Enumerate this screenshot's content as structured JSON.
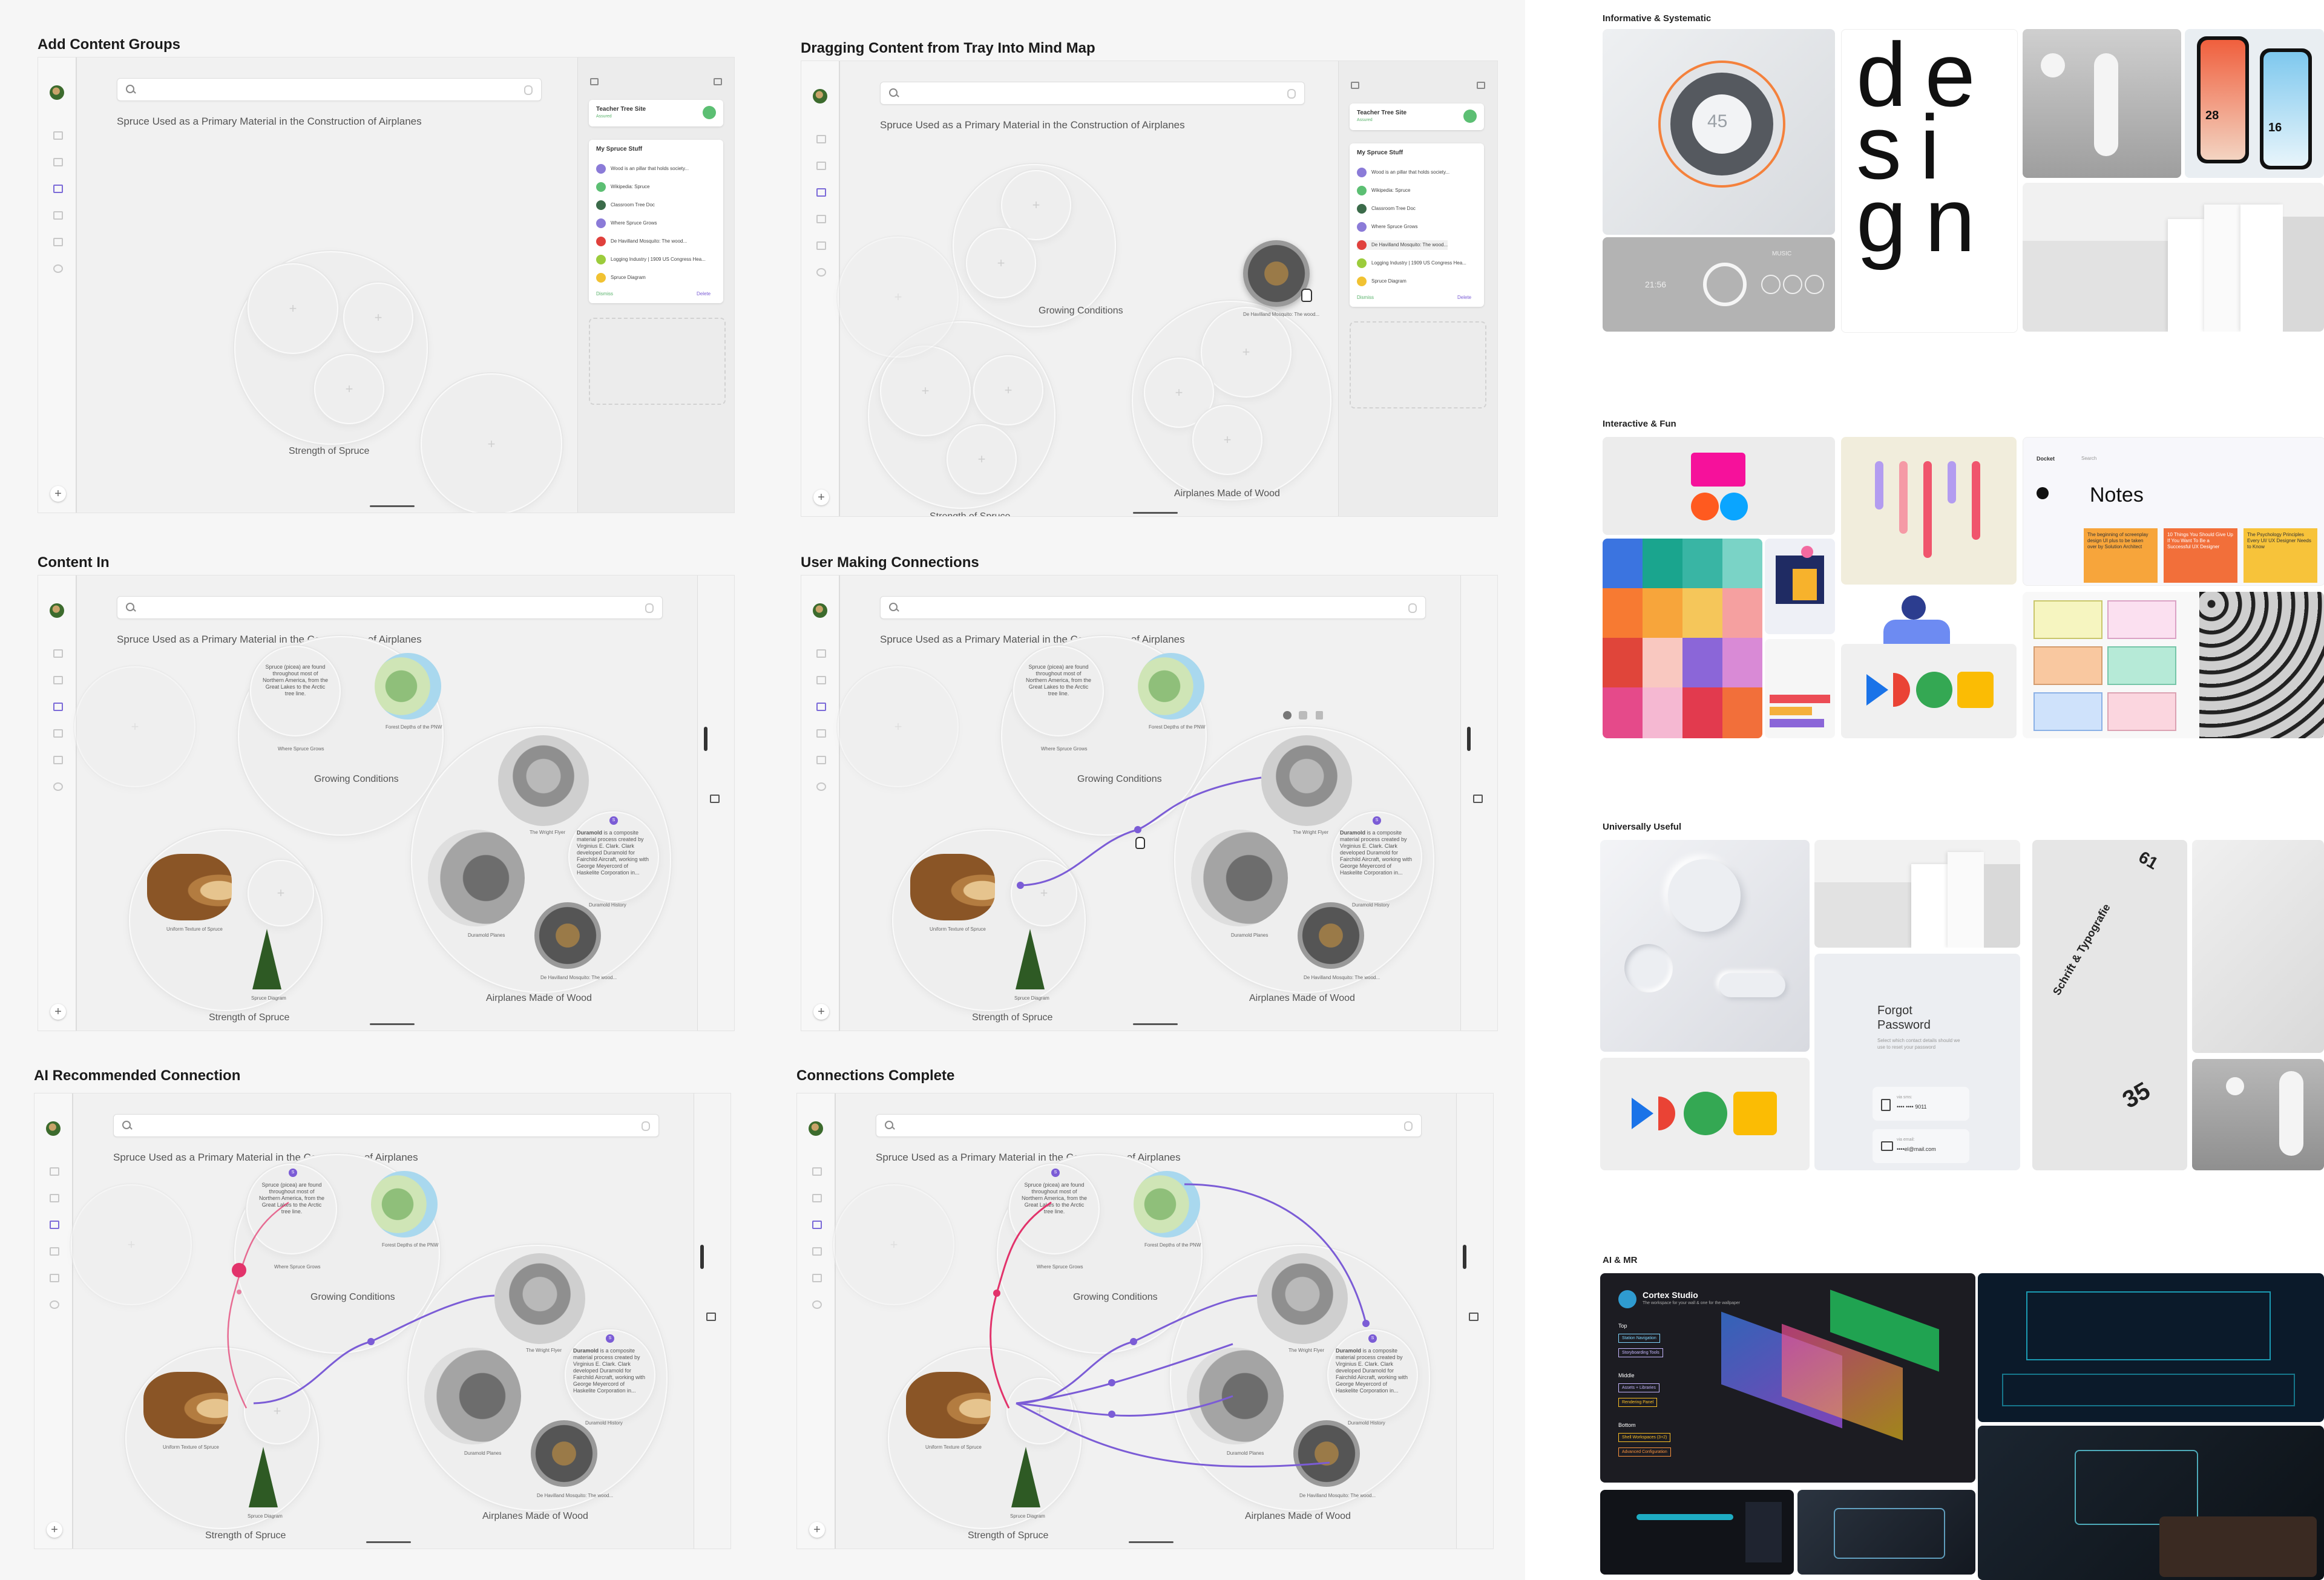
{
  "panels": [
    {
      "title": "Add Content Groups"
    },
    {
      "title": "Dragging Content from Tray Into Mind Map"
    },
    {
      "title": "Content In"
    },
    {
      "title": "User Making Connections"
    },
    {
      "title": "AI Recommended Connection"
    },
    {
      "title": "Connections Complete"
    }
  ],
  "mindmap": {
    "title": "Spruce Used as a Primary Material in the Construction of Airplanes",
    "strength": "Strength of Spruce",
    "growing": "Growing Conditions",
    "airplanes": "Airplanes Made of Wood",
    "where_grown": "Where Spruce Grows",
    "forest_depths": "Forest Depths of the PNW",
    "uniform_texture": "Uniform Texture of Spruce",
    "spruce_diagram": "Spruce Diagram",
    "wright_flyer": "The Wright Flyer",
    "duramold_planes": "Duramold Planes",
    "mosquito": "De Havilland Mosquito: The wood...",
    "duramold_history": "Duramold History",
    "spruce_blurb": "Spruce (picea) are found throughout most of Northern America, from the Great Lakes to the Arctic tree line.",
    "duramold_word": "Duramold",
    "duramold_blurb": "is a composite material process created by Virginius E. Clark. Clark developed Duramold for Fairchild Aircraft, working with George Meyercord of Haskelite Corporation in...",
    "duramold_blurb_short": "is a composite material process created by Virginius E. Clark. Clark developed Duramold for Fairchild Aircraft, working with George Meyercord of Haskelite Corporation in..."
  },
  "tray": {
    "teacher_site": "Teacher Tree Site",
    "teacher_status": "Assured",
    "stuff_title": "My Spruce Stuff",
    "items": [
      {
        "label": "Wood is an pillar that holds society...",
        "color": "#8b7bd8"
      },
      {
        "label": "Wikipedia: Spruce",
        "color": "#5cbf73"
      },
      {
        "label": "Classroom Tree Doc",
        "color": "#3b6b4a"
      },
      {
        "label": "Where Spruce Grows",
        "color": "#8b7bd8"
      },
      {
        "label": "De Havilland Mosquito: The wood...",
        "color": "#e0403c"
      },
      {
        "label": "Logging Industry | 1909 US Congress Hea...",
        "color": "#9ccc3c"
      },
      {
        "label": "Spruce Diagram",
        "color": "#f1c232"
      }
    ],
    "footer_left": "Dismiss",
    "footer_right": "Delete"
  },
  "moodboard": {
    "sections": [
      {
        "title": "Informative & Systematic"
      },
      {
        "title": "Interactive & Fun"
      },
      {
        "title": "Universally Useful"
      },
      {
        "title": "AI & MR"
      }
    ],
    "dial_value": "45",
    "time_value": "21:56",
    "music_label": "MUSIC",
    "phone_date_1": "28",
    "phone_date_2": "16",
    "notes_app": "Docket",
    "notes_search": "Search",
    "notes_title": "Notes",
    "notes_cards": [
      "The beginning of screenplay design UI plus to be taken over by Solution Architect",
      "10 Things You Should Give Up If You Want To Be a Successful UX Designer",
      "The Psychology Principles Every UI/ UX Designer Needs to Know"
    ],
    "forgot_title": "Forgot Password",
    "forgot_text": "Select which contact details should we use to reset your password",
    "forgot_phone_label": "via sms:",
    "forgot_phone": "•••• •••• 9011",
    "forgot_email_label": "via email:",
    "forgot_email": "••••el@mail.com",
    "cortex_title": "Cortex Studio",
    "cortex_sub": "The workspace for your wall & one for the wallpaper",
    "cortex_top": "Top",
    "cortex_top_items": [
      "Station Navigation",
      "Storyboarding Tools"
    ],
    "cortex_middle": "Middle",
    "cortex_middle_items": [
      "Assets + Libraries",
      "Rendering Panel"
    ],
    "cortex_bottom": "Bottom",
    "cortex_bottom_items": [
      "Shell Workspaces (3+2)",
      "Advanced Configuration"
    ],
    "design_letters": "design",
    "typo_title": "Schrift & Typografie",
    "typo_num_1": "61",
    "typo_num_2": "35"
  },
  "colors": {
    "accent_purple": "#7b5cd6",
    "ai_pink": "#e2336b",
    "green": "#5cbf73"
  }
}
